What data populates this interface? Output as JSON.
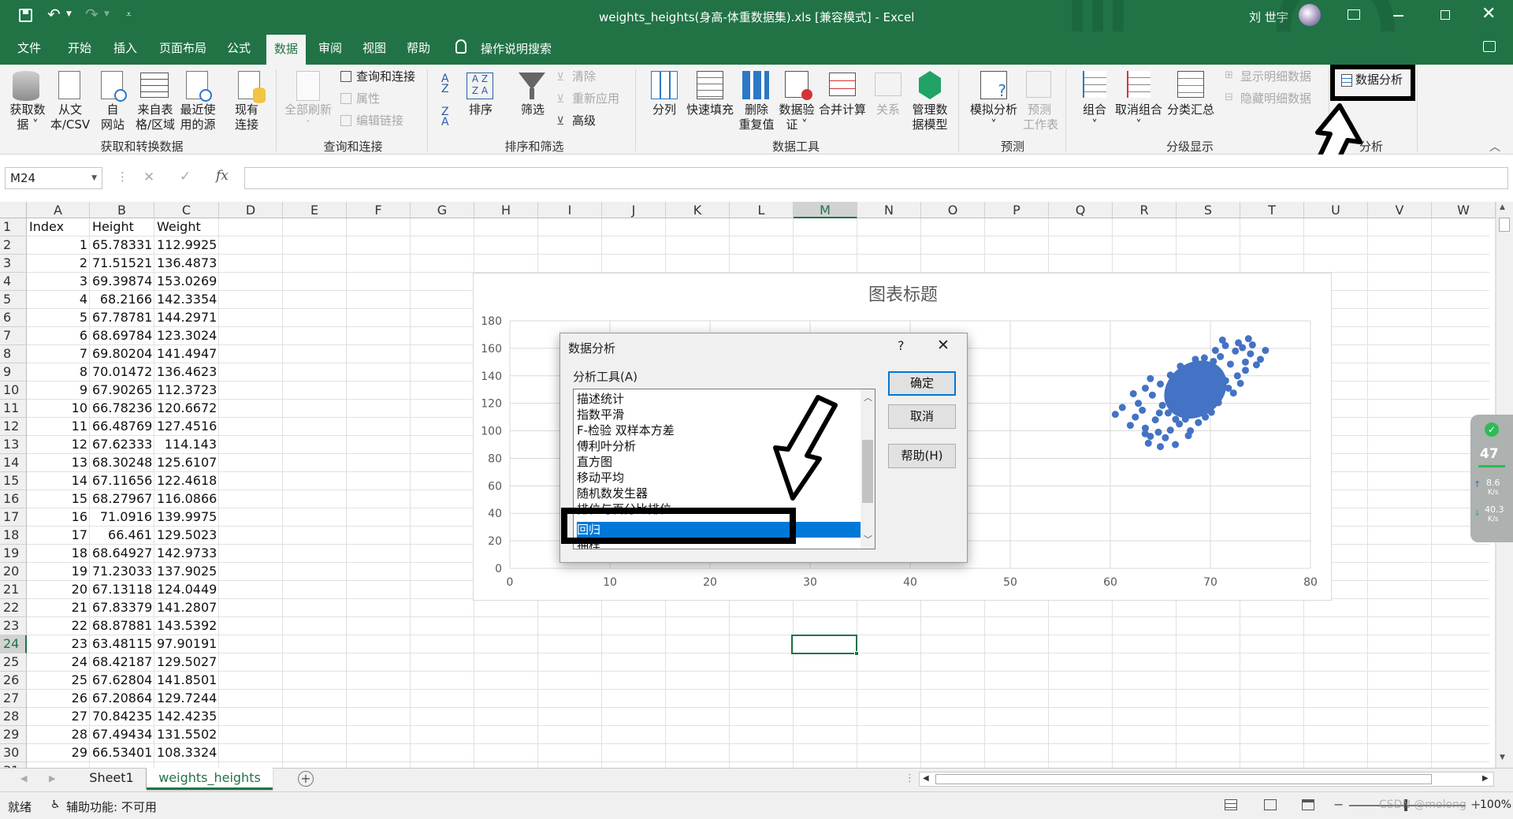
{
  "window": {
    "title": "weights_heights(身高-体重数据集).xls  [兼容模式]  -  Excel",
    "user": "刘 世宇"
  },
  "ribbon_tabs": [
    "文件",
    "开始",
    "插入",
    "页面布局",
    "公式",
    "数据",
    "审阅",
    "视图",
    "帮助"
  ],
  "active_tab": "数据",
  "tell_me": "操作说明搜索",
  "ribbon": {
    "get_data": "获取数\n据 ˅",
    "from_csv": "从文\n本/CSV",
    "from_web": "自\n网站",
    "from_table": "来自表\n格/区域",
    "recent_sources": "最近使\n用的源",
    "existing_conn": "现有\n连接",
    "group_get": "获取和转换数据",
    "refresh_all": "全部刷新",
    "queries_conn": "查询和连接",
    "properties": "属性",
    "edit_links": "编辑链接",
    "group_queries": "查询和连接",
    "sort": "排序",
    "filter": "筛选",
    "clear": "清除",
    "reapply": "重新应用",
    "advanced": "高级",
    "group_sort": "排序和筛选",
    "text_to_cols": "分列",
    "flash_fill": "快速填充",
    "remove_dup": "删除\n重复值",
    "data_valid": "数据验\n证 ˅",
    "consolidate": "合并计算",
    "relations": "关系",
    "data_model": "管理数\n据模型",
    "group_tools": "数据工具",
    "what_if": "模拟分析\n˅",
    "forecast": "预测\n工作表",
    "group_forecast": "预测",
    "group_btn": "组合\n˅",
    "ungroup": "取消组合\n˅",
    "subtotal": "分类汇总",
    "show_detail": "显示明细数据",
    "hide_detail": "隐藏明细数据",
    "group_outline": "分级显示",
    "data_analysis": "数据分析",
    "group_analysis": "分析"
  },
  "formula_bar": {
    "name_box": "M24",
    "fx": "fx",
    "value": ""
  },
  "columns": [
    "A",
    "B",
    "C",
    "D",
    "E",
    "F",
    "G",
    "H",
    "I",
    "J",
    "K",
    "L",
    "M",
    "N",
    "O",
    "P",
    "Q",
    "R",
    "S",
    "T",
    "U",
    "V",
    "W"
  ],
  "selected_column": "M",
  "selected_row": "24",
  "headers": [
    "Index",
    "Height",
    "Weight"
  ],
  "rows": [
    [
      "1",
      "65.78331",
      "112.9925"
    ],
    [
      "2",
      "71.51521",
      "136.4873"
    ],
    [
      "3",
      "69.39874",
      "153.0269"
    ],
    [
      "4",
      "68.2166",
      "142.3354"
    ],
    [
      "5",
      "67.78781",
      "144.2971"
    ],
    [
      "6",
      "68.69784",
      "123.3024"
    ],
    [
      "7",
      "69.80204",
      "141.4947"
    ],
    [
      "8",
      "70.01472",
      "136.4623"
    ],
    [
      "9",
      "67.90265",
      "112.3723"
    ],
    [
      "10",
      "66.78236",
      "120.6672"
    ],
    [
      "11",
      "66.48769",
      "127.4516"
    ],
    [
      "12",
      "67.62333",
      "114.143"
    ],
    [
      "13",
      "68.30248",
      "125.6107"
    ],
    [
      "14",
      "67.11656",
      "122.4618"
    ],
    [
      "15",
      "68.27967",
      "116.0866"
    ],
    [
      "16",
      "71.0916",
      "139.9975"
    ],
    [
      "17",
      "66.461",
      "129.5023"
    ],
    [
      "18",
      "68.64927",
      "142.9733"
    ],
    [
      "19",
      "71.23033",
      "137.9025"
    ],
    [
      "20",
      "67.13118",
      "124.0449"
    ],
    [
      "21",
      "67.83379",
      "141.2807"
    ],
    [
      "22",
      "68.87881",
      "143.5392"
    ],
    [
      "23",
      "63.48115",
      "97.90191"
    ],
    [
      "24",
      "68.42187",
      "129.5027"
    ],
    [
      "25",
      "67.62804",
      "141.8501"
    ],
    [
      "26",
      "67.20864",
      "129.7244"
    ],
    [
      "27",
      "70.84235",
      "142.4235"
    ],
    [
      "28",
      "67.49434",
      "131.5502"
    ],
    [
      "29",
      "66.53401",
      "108.3324"
    ]
  ],
  "chart_data": {
    "type": "scatter",
    "title": "图表标题",
    "xlim": [
      0,
      80
    ],
    "ylim": [
      0,
      180
    ],
    "x_ticks": [
      "0",
      "10",
      "20",
      "30",
      "40",
      "50",
      "60",
      "70",
      "80"
    ],
    "y_ticks": [
      "0",
      "20",
      "40",
      "60",
      "80",
      "100",
      "120",
      "140",
      "160",
      "180"
    ],
    "grid": true,
    "series": [
      {
        "color": "#4472c4",
        "points": [
          [
            65.78,
            112.99
          ],
          [
            71.52,
            136.49
          ],
          [
            69.4,
            153.03
          ],
          [
            68.22,
            142.34
          ],
          [
            67.79,
            144.3
          ],
          [
            68.7,
            123.3
          ],
          [
            69.8,
            141.49
          ],
          [
            70.01,
            136.46
          ],
          [
            67.9,
            112.37
          ],
          [
            66.78,
            120.67
          ],
          [
            66.49,
            127.45
          ],
          [
            67.62,
            114.14
          ],
          [
            68.3,
            125.61
          ],
          [
            67.12,
            122.46
          ],
          [
            68.28,
            116.09
          ],
          [
            71.09,
            140.0
          ],
          [
            66.46,
            129.5
          ],
          [
            68.65,
            142.97
          ],
          [
            71.23,
            137.9
          ],
          [
            67.13,
            124.04
          ],
          [
            67.83,
            141.28
          ],
          [
            68.88,
            143.54
          ],
          [
            63.48,
            97.9
          ],
          [
            68.42,
            129.5
          ],
          [
            67.63,
            141.85
          ],
          [
            67.21,
            129.72
          ],
          [
            70.84,
            142.42
          ],
          [
            67.49,
            131.55
          ],
          [
            66.53,
            108.33
          ],
          [
            72.5,
            158.0
          ],
          [
            73.2,
            160.5
          ],
          [
            74.0,
            156.0
          ],
          [
            75.0,
            152.0
          ],
          [
            74.6,
            148.0
          ],
          [
            73.5,
            150.0
          ],
          [
            70.5,
            158.5
          ],
          [
            71.5,
            162.0
          ],
          [
            72.8,
            164.0
          ],
          [
            63.5,
            102.0
          ],
          [
            64.0,
            96.0
          ],
          [
            62.5,
            110.0
          ],
          [
            64.8,
            99.0
          ],
          [
            65.5,
            95.0
          ],
          [
            66.0,
            100.5
          ],
          [
            63.2,
            115.0
          ],
          [
            62.8,
            120.0
          ],
          [
            64.2,
            126.0
          ],
          [
            65.0,
            134.0
          ],
          [
            66.0,
            140.5
          ],
          [
            67.0,
            147.0
          ],
          [
            68.5,
            152.0
          ],
          [
            70.0,
            147.5
          ],
          [
            69.0,
            118.0
          ],
          [
            70.5,
            126.0
          ],
          [
            71.8,
            131.0
          ],
          [
            72.7,
            140.0
          ],
          [
            73.5,
            144.0
          ],
          [
            69.5,
            110.0
          ],
          [
            66.9,
            105.0
          ],
          [
            68.0,
            100.0
          ],
          [
            65.2,
            118.5
          ],
          [
            66.2,
            116.0
          ],
          [
            69.7,
            132.0
          ],
          [
            68.9,
            130.5
          ],
          [
            70.3,
            150.5
          ],
          [
            71.0,
            154.0
          ],
          [
            72.0,
            148.5
          ],
          [
            64.5,
            108.0
          ],
          [
            64.9,
            113.0
          ],
          [
            67.5,
            108.5
          ],
          [
            66.7,
            134.5
          ],
          [
            65.9,
            126.5
          ],
          [
            69.2,
            137.0
          ],
          [
            70.8,
            120.5
          ],
          [
            72.3,
            127.5
          ],
          [
            73.0,
            134.5
          ],
          [
            61.2,
            117.0
          ],
          [
            60.5,
            112.0
          ],
          [
            62.0,
            104.0
          ],
          [
            63.8,
            91.0
          ],
          [
            65.0,
            88.5
          ],
          [
            66.5,
            90.0
          ],
          [
            74.2,
            162.5
          ],
          [
            75.5,
            158.5
          ],
          [
            73.8,
            167.0
          ],
          [
            71.2,
            166.0
          ],
          [
            67.8,
            96.5
          ],
          [
            68.8,
            106.0
          ],
          [
            70.1,
            113.5
          ],
          [
            62.3,
            127.0
          ],
          [
            63.5,
            131.0
          ],
          [
            64.0,
            138.0
          ]
        ]
      }
    ]
  },
  "dialog": {
    "title": "数据分析",
    "help_mark": "?",
    "label": "分析工具(A)",
    "items": [
      "描述统计",
      "指数平滑",
      "F-检验 双样本方差",
      "傅利叶分析",
      "直方图",
      "移动平均",
      "随机数发生器",
      "排位与百分比排位",
      "回归",
      "抽样"
    ],
    "selected": "回归",
    "ok": "确定",
    "cancel": "取消",
    "help": "帮助(H)"
  },
  "sheets": [
    "Sheet1",
    "weights_heights"
  ],
  "active_sheet": "weights_heights",
  "status": {
    "ready": "就绪",
    "accessibility": "辅助功能: 不可用",
    "zoom": "100%",
    "watermark": "CSDN @molong"
  },
  "net_widget": {
    "percent": "47",
    "up": "8.6",
    "down": "40.3",
    "unit": "K/s"
  }
}
